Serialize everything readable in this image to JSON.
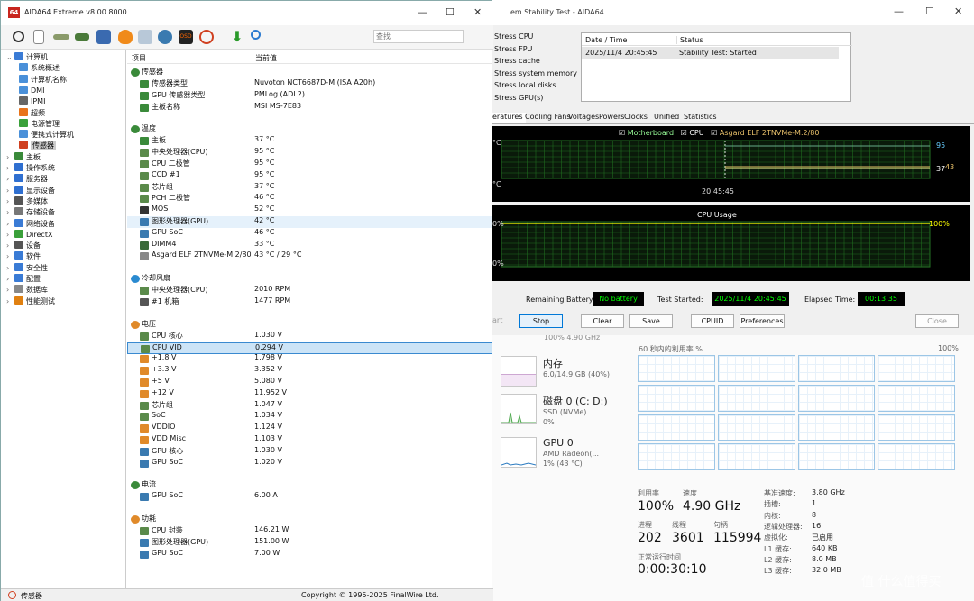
{
  "aida": {
    "title": "AIDA64 Extreme v8.00.8000",
    "app_icon": "64",
    "search_placeholder": "查找",
    "columns": {
      "item": "项目",
      "value": "当前值"
    },
    "status_left": "传感器",
    "status_right": "Copyright © 1995-2025 FinalWire Ltd.",
    "tree": [
      {
        "label": "计算机",
        "level": 0,
        "icon": "computer-icon",
        "color": "#3a7bd5"
      },
      {
        "label": "系统概述",
        "level": 1,
        "icon": "monitor-icon",
        "color": "#4a90d9"
      },
      {
        "label": "计算机名称",
        "level": 1,
        "icon": "monitor-icon",
        "color": "#4a90d9"
      },
      {
        "label": "DMI",
        "level": 1,
        "icon": "monitor-icon",
        "color": "#4a90d9"
      },
      {
        "label": "IPMI",
        "level": 1,
        "icon": "server-icon",
        "color": "#666666"
      },
      {
        "label": "超频",
        "level": 1,
        "icon": "flame-icon",
        "color": "#e8731a"
      },
      {
        "label": "电源管理",
        "level": 1,
        "icon": "power-icon",
        "color": "#3aa03a"
      },
      {
        "label": "便携式计算机",
        "level": 1,
        "icon": "laptop-icon",
        "color": "#4a90d9"
      },
      {
        "label": "传感器",
        "level": 1,
        "icon": "gauge-icon",
        "color": "#d04020",
        "selected": true
      },
      {
        "label": "主板",
        "level": 0,
        "icon": "motherboard-icon",
        "color": "#3a8a3a"
      },
      {
        "label": "操作系统",
        "level": 0,
        "icon": "windows-icon",
        "color": "#2f6fd0"
      },
      {
        "label": "服务器",
        "level": 0,
        "icon": "server-icon",
        "color": "#2f6fd0"
      },
      {
        "label": "显示设备",
        "level": 0,
        "icon": "display-icon",
        "color": "#2f6fd0"
      },
      {
        "label": "多媒体",
        "level": 0,
        "icon": "speaker-icon",
        "color": "#555555"
      },
      {
        "label": "存储设备",
        "level": 0,
        "icon": "disk-icon",
        "color": "#777777"
      },
      {
        "label": "网络设备",
        "level": 0,
        "icon": "network-icon",
        "color": "#3a7bd5"
      },
      {
        "label": "DirectX",
        "level": 0,
        "icon": "directx-icon",
        "color": "#3aa03a"
      },
      {
        "label": "设备",
        "level": 0,
        "icon": "device-icon",
        "color": "#555555"
      },
      {
        "label": "软件",
        "level": 0,
        "icon": "software-icon",
        "color": "#3a7bd5"
      },
      {
        "label": "安全性",
        "level": 0,
        "icon": "shield-icon",
        "color": "#3a7bd5"
      },
      {
        "label": "配置",
        "level": 0,
        "icon": "config-icon",
        "color": "#3a7bd5"
      },
      {
        "label": "数据库",
        "level": 0,
        "icon": "database-icon",
        "color": "#888888"
      },
      {
        "label": "性能测试",
        "level": 0,
        "icon": "benchmark-icon",
        "color": "#e08010"
      }
    ],
    "groups": [
      {
        "title": "传感器",
        "icon": "sensor-icon",
        "rows": [
          {
            "item": "传感器类型",
            "value": "Nuvoton NCT6687D-M  (ISA A20h)",
            "icon": "sensor-icon"
          },
          {
            "item": "GPU 传感器类型",
            "value": "PMLog  (ADL2)",
            "icon": "sensor-icon"
          },
          {
            "item": "主板名称",
            "value": "MSI MS-7E83",
            "icon": "motherboard-icon"
          }
        ]
      },
      {
        "title": "温度",
        "icon": "thermometer-icon",
        "rows": [
          {
            "item": "主板",
            "value": "37 °C",
            "icon": "motherboard-icon"
          },
          {
            "item": "中央处理器(CPU)",
            "value": "95 °C",
            "icon": "chip-icon"
          },
          {
            "item": "CPU 二极管",
            "value": "95 °C",
            "icon": "chip-icon"
          },
          {
            "item": "CCD #1",
            "value": "95 °C",
            "icon": "chip-icon"
          },
          {
            "item": "芯片组",
            "value": "37 °C",
            "icon": "chip-icon"
          },
          {
            "item": "PCH 二极管",
            "value": "46 °C",
            "icon": "chip-icon"
          },
          {
            "item": "MOS",
            "value": "52 °C",
            "icon": "mos-icon"
          },
          {
            "item": "图形处理器(GPU)",
            "value": "42 °C",
            "icon": "gpu-icon",
            "highlight": true
          },
          {
            "item": "GPU SoC",
            "value": "46 °C",
            "icon": "gpu-icon"
          },
          {
            "item": "DIMM4",
            "value": "33 °C",
            "icon": "memory-icon"
          },
          {
            "item": "Asgard ELF 2TNVMe-M.2/80",
            "value": "43 °C / 29 °C",
            "icon": "disk-icon"
          }
        ]
      },
      {
        "title": "冷却风扇",
        "icon": "fan-icon",
        "rows": [
          {
            "item": "中央处理器(CPU)",
            "value": "2010 RPM",
            "icon": "chip-icon"
          },
          {
            "item": "#1 机箱",
            "value": "1477 RPM",
            "icon": "case-icon"
          }
        ]
      },
      {
        "title": "电压",
        "icon": "voltage-icon",
        "rows": [
          {
            "item": "CPU 核心",
            "value": "1.030 V",
            "icon": "chip-icon"
          },
          {
            "item": "CPU VID",
            "value": "0.294 V",
            "icon": "chip-icon",
            "selected": true
          },
          {
            "item": "+1.8 V",
            "value": "1.798 V",
            "icon": "voltage-icon"
          },
          {
            "item": "+3.3 V",
            "value": "3.352 V",
            "icon": "voltage-icon"
          },
          {
            "item": "+5 V",
            "value": "5.080 V",
            "icon": "voltage-icon"
          },
          {
            "item": "+12 V",
            "value": "11.952 V",
            "icon": "voltage-icon"
          },
          {
            "item": "芯片组",
            "value": "1.047 V",
            "icon": "chip-icon"
          },
          {
            "item": "SoC",
            "value": "1.034 V",
            "icon": "chip-icon"
          },
          {
            "item": "VDDIO",
            "value": "1.124 V",
            "icon": "voltage-icon"
          },
          {
            "item": "VDD Misc",
            "value": "1.103 V",
            "icon": "voltage-icon"
          },
          {
            "item": "GPU 核心",
            "value": "1.030 V",
            "icon": "gpu-icon"
          },
          {
            "item": "GPU SoC",
            "value": "1.020 V",
            "icon": "gpu-icon"
          }
        ]
      },
      {
        "title": "电流",
        "icon": "current-icon",
        "rows": [
          {
            "item": "GPU SoC",
            "value": "6.00 A",
            "icon": "gpu-icon"
          }
        ]
      },
      {
        "title": "功耗",
        "icon": "power-icon",
        "rows": [
          {
            "item": "CPU 封装",
            "value": "146.21 W",
            "icon": "chip-icon"
          },
          {
            "item": "图形处理器(GPU)",
            "value": "151.00 W",
            "icon": "gpu-icon"
          },
          {
            "item": "GPU SoC",
            "value": "7.00 W",
            "icon": "gpu-icon"
          }
        ]
      }
    ]
  },
  "stability": {
    "title": "em Stability Test - AIDA64",
    "stress_items": [
      "Stress CPU",
      "Stress FPU",
      "Stress cache",
      "Stress system memory",
      "Stress local disks",
      "Stress GPU(s)"
    ],
    "log_headers": {
      "date": "Date / Time",
      "status": "Status"
    },
    "log_rows": [
      {
        "date": "2025/11/4 20:45:45",
        "status": "Stability Test: Started"
      }
    ],
    "tabs": [
      "eratures",
      "Cooling Fans",
      "Voltages",
      "Powers",
      "Clocks",
      "Unified",
      "Statistics"
    ],
    "temp_legend": [
      "Motherboard",
      "CPU",
      "Asgard ELF 2TNVMe-M.2/80"
    ],
    "temp_axis_top": "°C",
    "temp_axis_bottom": "°C",
    "temp_time": "20:45:45",
    "temp_val_95": "95",
    "temp_val_37": "37",
    "temp_val_43": "43",
    "cpu_usage_title": "CPU Usage",
    "cpu_axis_top": "0%",
    "cpu_axis_bottom": "0%",
    "cpu_val": "100%",
    "remaining_battery_label": "Remaining Battery:",
    "remaining_battery_value": "No battery",
    "test_started_label": "Test Started:",
    "test_started_value": "2025/11/4 20:45:45",
    "elapsed_label": "Elapsed Time:",
    "elapsed_value": "00:13:35",
    "buttons": {
      "start": "art",
      "stop": "Stop",
      "clear": "Clear",
      "save": "Save",
      "cpuid": "CPUID",
      "preferences": "Preferences",
      "close": "Close"
    }
  },
  "taskmgr": {
    "cpu_cut": "100% 4.90 GHz",
    "graph_label": "60 秒内的利用率 %",
    "graph_max": "100%",
    "memory_name": "内存",
    "memory_sub": "6.0/14.9 GB (40%)",
    "disk_name": "磁盘 0 (C: D:)",
    "disk_sub1": "SSD (NVMe)",
    "disk_sub2": "0%",
    "gpu_name": "GPU 0",
    "gpu_sub1": "AMD Radeon(...",
    "gpu_sub2": "1% (43 °C)",
    "util_label": "利用率",
    "util_value": "100%",
    "speed_label": "速度",
    "speed_value": "4.90 GHz",
    "proc_label": "进程",
    "proc_value": "202",
    "thread_label": "线程",
    "thread_value": "3601",
    "handle_label": "句柄",
    "handle_value": "115994",
    "uptime_label": "正常运行时间",
    "uptime_value": "0:00:30:10",
    "specs": [
      {
        "k": "基准速度:",
        "v": "3.80 GHz"
      },
      {
        "k": "插槽:",
        "v": "1"
      },
      {
        "k": "内核:",
        "v": "8"
      },
      {
        "k": "逻辑处理器:",
        "v": "16"
      },
      {
        "k": "虚拟化:",
        "v": "已启用"
      },
      {
        "k": "L1 缓存:",
        "v": "640 KB"
      },
      {
        "k": "L2 缓存:",
        "v": "8.0 MB"
      },
      {
        "k": "L3 缓存:",
        "v": "32.0 MB"
      }
    ]
  },
  "watermark": "值 什么值得买"
}
